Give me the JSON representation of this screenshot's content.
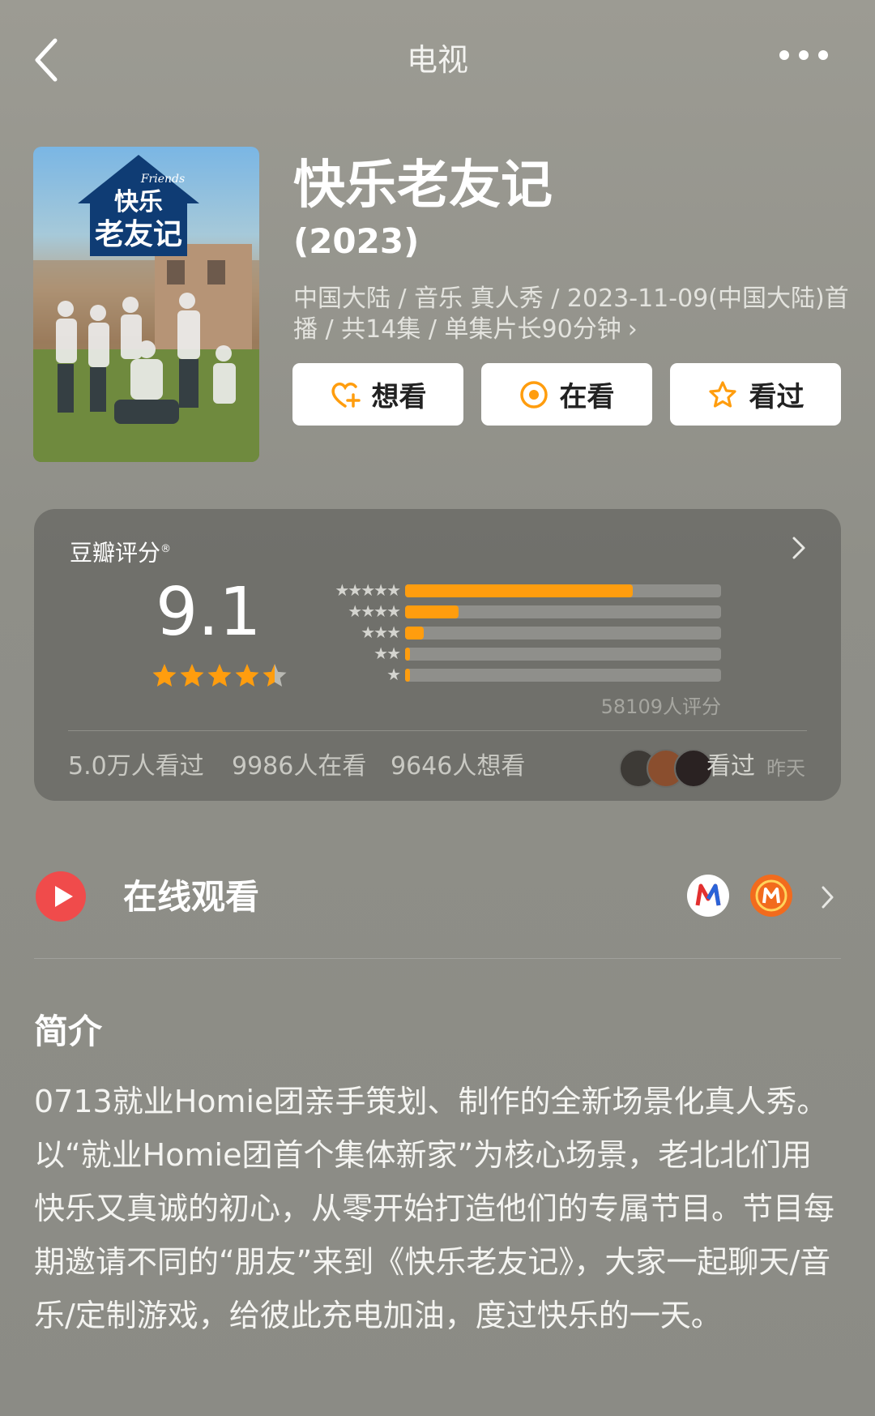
{
  "header": {
    "title": "电视"
  },
  "show": {
    "title": "快乐老友记",
    "year": "(2023)",
    "meta": "中国大陆 / 音乐 真人秀 / 2023-11-09(中国大陆)首播 / 共14集 / 单集片长90分钟",
    "poster_title": "快乐老友记",
    "poster_subtitle": "Friends"
  },
  "actions": [
    {
      "label": "想看",
      "icon": "heart-plus-icon"
    },
    {
      "label": "在看",
      "icon": "target-icon"
    },
    {
      "label": "看过",
      "icon": "star-icon"
    }
  ],
  "rating": {
    "label": "豆瓣评分",
    "score": "9.1",
    "stars_value": 4.5,
    "distribution": [
      {
        "stars": 5,
        "fraction": 0.72
      },
      {
        "stars": 4,
        "fraction": 0.17
      },
      {
        "stars": 3,
        "fraction": 0.06
      },
      {
        "stars": 2,
        "fraction": 0.015
      },
      {
        "stars": 1,
        "fraction": 0.015
      }
    ],
    "count_text": "58109人评分",
    "stats": {
      "watched": "5.0万人看过",
      "watching": "9986人在看",
      "want": "9646人想看"
    },
    "friend_status": "看过",
    "friend_time": "昨天"
  },
  "online": {
    "title": "在线观看"
  },
  "intro": {
    "title": "简介",
    "text": "0713就业Homie团亲手策划、制作的全新场景化真人秀。以“就业Homie团首个集体新家”为核心场景，老北北们用快乐又真诚的初心，从零开始打造他们的专属节目。节目每期邀请不同的“朋友”来到《快乐老友记》，大家一起聊天/音乐/定制游戏，给彼此充电加油，度过快乐的一天。"
  },
  "colors": {
    "accent": "#ff9d0e",
    "star": "#ff9d0e",
    "play": "#f04b4b"
  }
}
